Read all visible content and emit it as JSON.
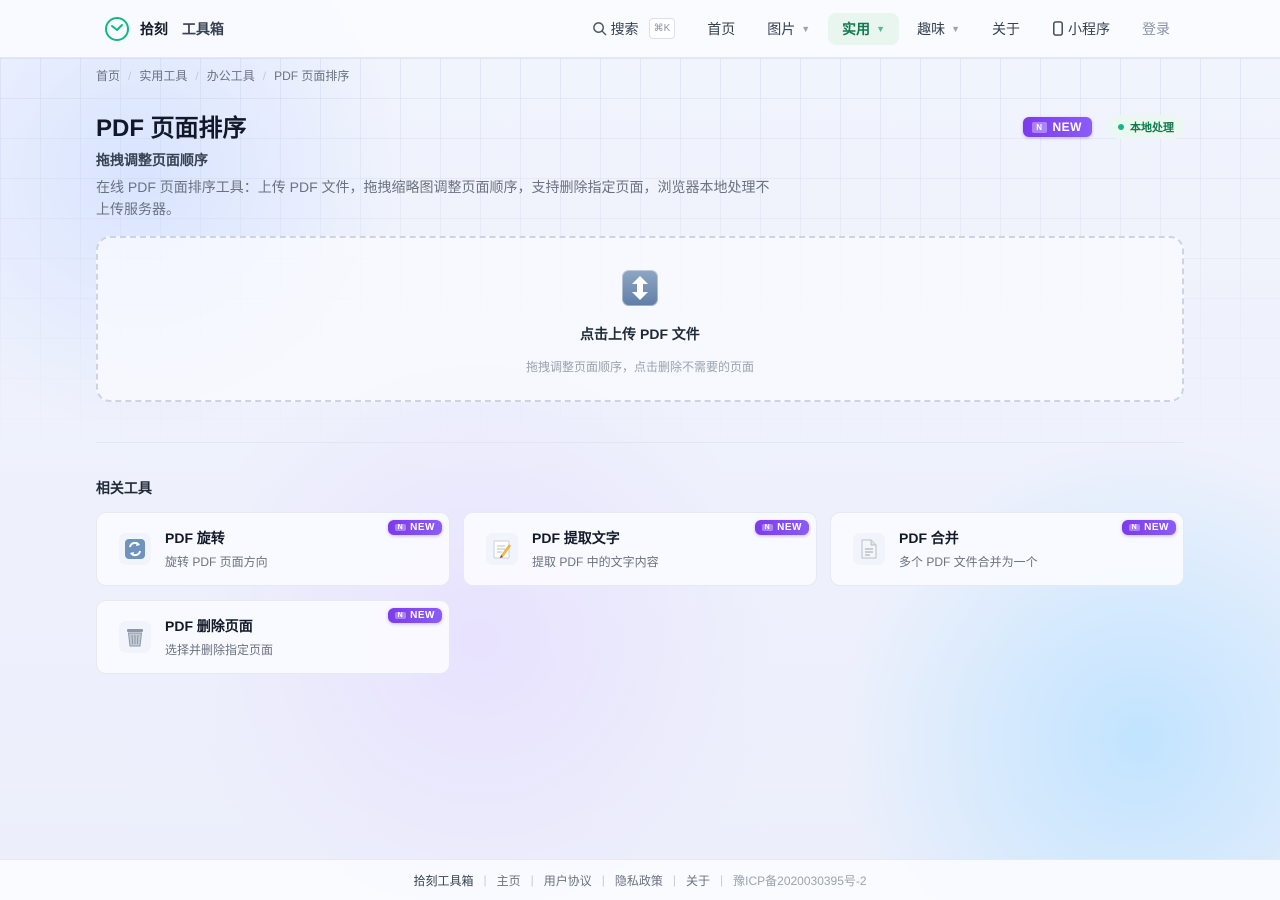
{
  "header": {
    "brand_name": "拾刻",
    "brand_sub": "工具箱",
    "search_label": "搜索",
    "search_shortcut": "⌘K",
    "nav": [
      {
        "label": "首页"
      },
      {
        "label": "图片"
      },
      {
        "label": "实用"
      },
      {
        "label": "趣味"
      },
      {
        "label": "关于"
      },
      {
        "label": "小程序"
      }
    ],
    "login_label": "登录"
  },
  "breadcrumb": [
    "首页",
    "实用工具",
    "办公工具",
    "PDF 页面排序"
  ],
  "page": {
    "title": "PDF 页面排序",
    "subtitle": "拖拽调整页面顺序",
    "description": "在线 PDF 页面排序工具：上传 PDF 文件，拖拽缩略图调整页面顺序，支持删除指定页面，浏览器本地处理不上传服务器。",
    "new_badge": "NEW",
    "new_badge_n": "N",
    "local_badge": "本地处理"
  },
  "upload": {
    "title": "点击上传 PDF 文件",
    "hint": "拖拽调整页面顺序，点击删除不需要的页面"
  },
  "related": {
    "title": "相关工具",
    "badge": "NEW",
    "badge_n": "N",
    "items": [
      {
        "name": "PDF 旋转",
        "desc": "旋转 PDF 页面方向",
        "icon": "rotate-icon"
      },
      {
        "name": "PDF 提取文字",
        "desc": "提取 PDF 中的文字内容",
        "icon": "memo-icon"
      },
      {
        "name": "PDF 合并",
        "desc": "多个 PDF 文件合并为一个",
        "icon": "document-icon"
      },
      {
        "name": "PDF 删除页面",
        "desc": "选择并删除指定页面",
        "icon": "trash-icon"
      }
    ]
  },
  "footer": {
    "brand": "拾刻工具箱",
    "links": [
      "主页",
      "用户协议",
      "隐私政策",
      "关于"
    ],
    "icp": "豫ICP备2020030395号-2"
  },
  "colors": {
    "accent_green": "#0f7a4f",
    "badge_purple": "#7c3aed"
  }
}
